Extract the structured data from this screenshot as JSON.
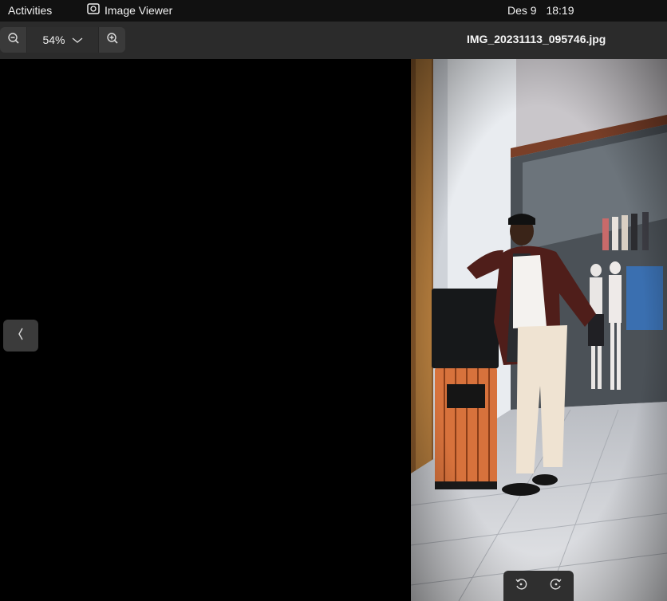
{
  "topbar": {
    "activities_label": "Activities",
    "app_name": "Image Viewer",
    "date": "Des 9",
    "time": "18:19"
  },
  "toolbar": {
    "zoom_level": "54%",
    "zoom_out_icon": "zoom-out-icon",
    "zoom_in_icon": "zoom-in-icon",
    "filename": "IMG_20231113_095746.jpg"
  },
  "navigation": {
    "previous_icon": "chevron-left-icon"
  },
  "rotation": {
    "rotate_left_icon": "rotate-left-icon",
    "rotate_right_icon": "rotate-right-icon"
  }
}
